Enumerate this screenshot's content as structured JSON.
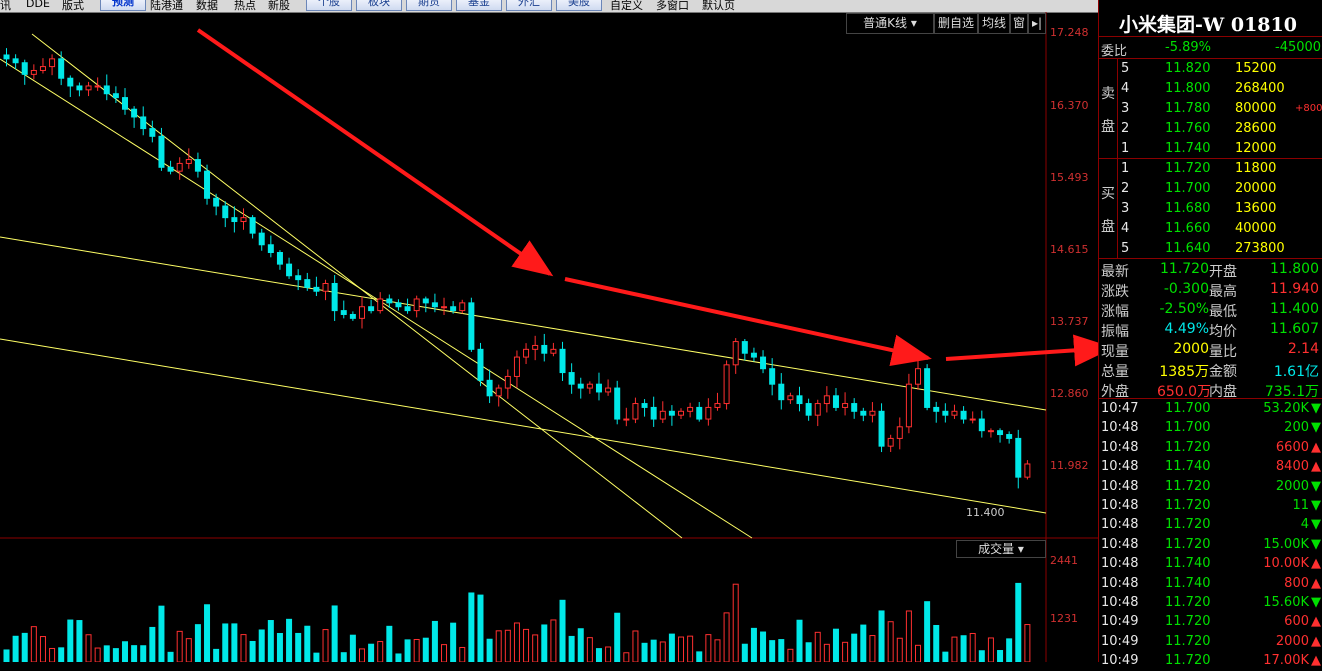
{
  "toolbar": {
    "items": [
      "讯",
      "DDE",
      "版式"
    ],
    "buttons": [
      "预测",
      "陆港通",
      "数据",
      "热点",
      "新股"
    ],
    "tabs": [
      "个股",
      "板块",
      "期货",
      "基金",
      "外汇",
      "美股"
    ],
    "right_items": [
      "自定义",
      "多窗口",
      "默认页"
    ]
  },
  "chart_controls": {
    "kline_type": "普通K线",
    "delete_fav": "删自选",
    "ma": "均线",
    "window": "窗",
    "volume_label": "成交量"
  },
  "price_axis": [
    "17.248",
    "16.370",
    "15.493",
    "14.615",
    "13.737",
    "12.860",
    "11.982"
  ],
  "volume_axis": [
    "2441",
    "1231"
  ],
  "low_marker": "11.400",
  "stock": {
    "name": "小米集团-W",
    "code": "01810"
  },
  "weibi": {
    "label": "委比",
    "pct": "-5.89%",
    "diff": "-45000"
  },
  "sell": {
    "label1": "卖",
    "label2": "盘",
    "levels": [
      {
        "lvl": "5",
        "price": "11.820",
        "vol": "15200",
        "chg": ""
      },
      {
        "lvl": "4",
        "price": "11.800",
        "vol": "268400",
        "chg": ""
      },
      {
        "lvl": "3",
        "price": "11.780",
        "vol": "80000",
        "chg": "+800"
      },
      {
        "lvl": "2",
        "price": "11.760",
        "vol": "28600",
        "chg": ""
      },
      {
        "lvl": "1",
        "price": "11.740",
        "vol": "12000",
        "chg": ""
      }
    ]
  },
  "buy": {
    "label1": "买",
    "label2": "盘",
    "levels": [
      {
        "lvl": "1",
        "price": "11.720",
        "vol": "11800"
      },
      {
        "lvl": "2",
        "price": "11.700",
        "vol": "20000"
      },
      {
        "lvl": "3",
        "price": "11.680",
        "vol": "13600"
      },
      {
        "lvl": "4",
        "price": "11.660",
        "vol": "40000"
      },
      {
        "lvl": "5",
        "price": "11.640",
        "vol": "273800"
      }
    ]
  },
  "stats": [
    {
      "l1": "最新",
      "v1": "11.720",
      "l2": "开盘",
      "v2": "11.800"
    },
    {
      "l1": "涨跌",
      "v1": "-0.300",
      "l2": "最高",
      "v2": "11.940"
    },
    {
      "l1": "涨幅",
      "v1": "-2.50%",
      "l2": "最低",
      "v2": "11.400"
    },
    {
      "l1": "振幅",
      "v1": "4.49%",
      "l2": "均价",
      "v2": "11.607"
    },
    {
      "l1": "现量",
      "v1": "2000",
      "l2": "量比",
      "v2": "2.14"
    },
    {
      "l1": "总量",
      "v1": "1385万",
      "l2": "金额",
      "v2": "1.61亿"
    },
    {
      "l1": "外盘",
      "v1": "650.0万",
      "l2": "内盘",
      "v2": "735.1万"
    }
  ],
  "trades": [
    {
      "t": "10:47",
      "p": "11.700",
      "v": "53.20K",
      "d": "down"
    },
    {
      "t": "10:48",
      "p": "11.700",
      "v": "200",
      "d": "down"
    },
    {
      "t": "10:48",
      "p": "11.720",
      "v": "6600",
      "d": "up"
    },
    {
      "t": "10:48",
      "p": "11.740",
      "v": "8400",
      "d": "up"
    },
    {
      "t": "10:48",
      "p": "11.720",
      "v": "2000",
      "d": "down"
    },
    {
      "t": "10:48",
      "p": "11.720",
      "v": "11",
      "d": "down"
    },
    {
      "t": "10:48",
      "p": "11.720",
      "v": "4",
      "d": "down"
    },
    {
      "t": "10:48",
      "p": "11.720",
      "v": "15.00K",
      "d": "down"
    },
    {
      "t": "10:48",
      "p": "11.740",
      "v": "10.00K",
      "d": "up"
    },
    {
      "t": "10:48",
      "p": "11.740",
      "v": "800",
      "d": "up"
    },
    {
      "t": "10:48",
      "p": "11.720",
      "v": "15.60K",
      "d": "down"
    },
    {
      "t": "10:49",
      "p": "11.720",
      "v": "600",
      "d": "up"
    },
    {
      "t": "10:49",
      "p": "11.720",
      "v": "2000",
      "d": "up"
    },
    {
      "t": "10:49",
      "p": "11.720",
      "v": "17.00K",
      "d": "up"
    }
  ],
  "colors": {
    "up": "#ff3030",
    "down": "#00e8e8",
    "bg": "#000000",
    "trend": "#ffff66",
    "arrow": "#ff1a1a"
  },
  "chart_data": {
    "type": "candlestick",
    "ylim": [
      11.1,
      17.4
    ],
    "close_series": [
      16.95,
      16.9,
      16.75,
      16.8,
      16.85,
      16.95,
      16.7,
      16.6,
      16.55,
      16.6,
      16.6,
      16.5,
      16.45,
      16.3,
      16.2,
      16.05,
      15.95,
      15.55,
      15.5,
      15.6,
      15.65,
      15.5,
      15.15,
      15.05,
      14.9,
      14.85,
      14.9,
      14.7,
      14.55,
      14.45,
      14.3,
      14.15,
      14.1,
      14.0,
      13.95,
      14.05,
      13.7,
      13.65,
      13.6,
      13.75,
      13.7,
      13.85,
      13.8,
      13.75,
      13.7,
      13.85,
      13.8,
      13.75,
      13.75,
      13.7,
      13.8,
      13.2,
      12.8,
      12.6,
      12.7,
      12.85,
      13.1,
      13.2,
      13.25,
      13.15,
      13.2,
      12.9,
      12.75,
      12.7,
      12.75,
      12.65,
      12.7,
      12.3,
      12.3,
      12.5,
      12.45,
      12.3,
      12.4,
      12.35,
      12.4,
      12.45,
      12.3,
      12.45,
      12.5,
      13.0,
      13.3,
      13.15,
      13.1,
      12.95,
      12.75,
      12.55,
      12.6,
      12.5,
      12.35,
      12.5,
      12.6,
      12.45,
      12.5,
      12.4,
      12.35,
      12.4,
      11.95,
      12.05,
      12.2,
      12.75,
      12.95,
      12.45,
      12.4,
      12.35,
      12.4,
      12.3,
      12.3,
      12.15,
      12.15,
      12.1,
      12.05,
      11.55,
      11.72
    ]
  }
}
